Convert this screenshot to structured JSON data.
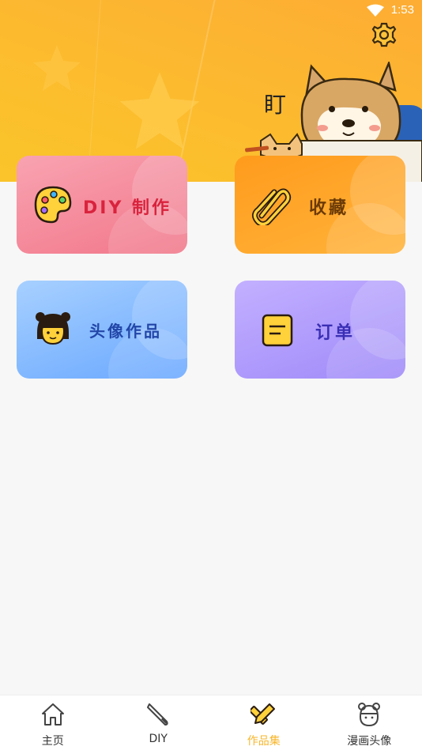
{
  "status_bar": {
    "time": "1:53"
  },
  "header": {
    "mascot_caption": "盯"
  },
  "cards": [
    {
      "id": "diy",
      "label": "DIY 制作",
      "icon": "palette-icon"
    },
    {
      "id": "favorites",
      "label": "收藏",
      "icon": "paperclip-icon"
    },
    {
      "id": "avatar_works",
      "label": "头像作品",
      "icon": "cartoon-girl-icon"
    },
    {
      "id": "orders",
      "label": "订单",
      "icon": "note-icon"
    }
  ],
  "tabbar": {
    "items": [
      {
        "label": "主页",
        "icon": "home-icon",
        "active": false
      },
      {
        "label": "DIY",
        "icon": "brush-icon",
        "active": false
      },
      {
        "label": "作品集",
        "icon": "pencil-ruler-icon",
        "active": true
      },
      {
        "label": "漫画头像",
        "icon": "avatar-face-icon",
        "active": false
      }
    ]
  },
  "colors": {
    "accent": "#f7b62b",
    "header_top": "#fdac34",
    "header_bottom": "#f9c629"
  }
}
